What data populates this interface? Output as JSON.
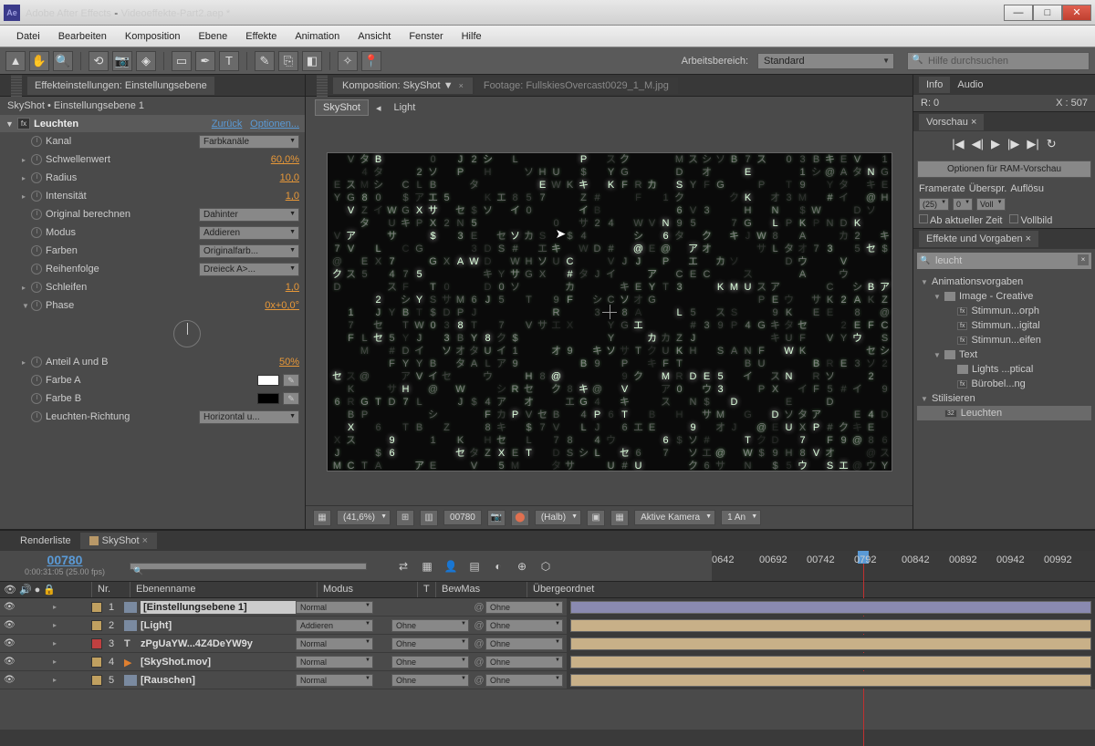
{
  "titlebar": {
    "app": "Adobe After Effects",
    "file": "Videoeffekte-Part2.aep *"
  },
  "menu": [
    "Datei",
    "Bearbeiten",
    "Komposition",
    "Ebene",
    "Effekte",
    "Animation",
    "Ansicht",
    "Fenster",
    "Hilfe"
  ],
  "toolbar": {
    "workspace_label": "Arbeitsbereich:",
    "workspace": "Standard",
    "search_placeholder": "Hilfe durchsuchen"
  },
  "effects_panel": {
    "tab": "Effekteinstellungen: Einstellungsebene",
    "path": "SkyShot • Einstellungsebene 1",
    "effect_name": "Leuchten",
    "links": {
      "reset": "Zurück",
      "options": "Optionen..."
    },
    "props": {
      "kanal": {
        "label": "Kanal",
        "value": "Farbkanäle"
      },
      "schwellenwert": {
        "label": "Schwellenwert",
        "value": "60,0%"
      },
      "radius": {
        "label": "Radius",
        "value": "10,0"
      },
      "intensitaet": {
        "label": "Intensität",
        "value": "1,0"
      },
      "original": {
        "label": "Original berechnen",
        "value": "Dahinter"
      },
      "modus": {
        "label": "Modus",
        "value": "Addieren"
      },
      "farben": {
        "label": "Farben",
        "value": "Originalfarb..."
      },
      "reihenfolge": {
        "label": "Reihenfolge",
        "value": "Dreieck A>..."
      },
      "schleifen": {
        "label": "Schleifen",
        "value": "1,0"
      },
      "phase": {
        "label": "Phase",
        "value": "0x+0,0°"
      },
      "anteil": {
        "label": "Anteil A und B",
        "value": "50%"
      },
      "farbeA": {
        "label": "Farbe A",
        "swatch": "#ffffff"
      },
      "farbeB": {
        "label": "Farbe B",
        "swatch": "#000000"
      },
      "richtung": {
        "label": "Leuchten-Richtung",
        "value": "Horizontal u..."
      }
    }
  },
  "comp_panel": {
    "tab_active": "Komposition: SkyShot",
    "tab_inactive": "Footage: FullskiesOvercast0029_1_M.jpg",
    "breadcrumb": [
      "SkyShot",
      "Light"
    ],
    "viewer_bar": {
      "zoom": "(41,6%)",
      "frame": "00780",
      "res": "(Halb)",
      "camera": "Aktive Kamera",
      "views": "1 An"
    }
  },
  "info_panel": {
    "tab1": "Info",
    "tab2": "Audio",
    "r": "R:  0",
    "x": "X : 507"
  },
  "preview_panel": {
    "tab": "Vorschau",
    "ram_btn": "Optionen für RAM-Vorschau",
    "labels": {
      "framerate": "Framerate",
      "skip": "Überspr.",
      "res": "Auflösu"
    },
    "values": {
      "framerate": "(25)",
      "skip": "0",
      "res": "Voll"
    },
    "checks": {
      "ab": "Ab aktueller Zeit",
      "vollbild": "Vollbild"
    }
  },
  "ep_panel": {
    "tab": "Effekte und Vorgaben",
    "search": "leucht",
    "tree": [
      {
        "d": 0,
        "tw": "▼",
        "label": "Animationsvorgaben"
      },
      {
        "d": 1,
        "tw": "▼",
        "icon": "folder",
        "label": "Image - Creative"
      },
      {
        "d": 2,
        "icon": "fx",
        "label": "Stimmun...orph"
      },
      {
        "d": 2,
        "icon": "fx",
        "label": "Stimmun...igital"
      },
      {
        "d": 2,
        "icon": "fx",
        "label": "Stimmun...eifen"
      },
      {
        "d": 1,
        "tw": "▼",
        "icon": "folder",
        "label": "Text"
      },
      {
        "d": 2,
        "tw": "",
        "icon": "folder",
        "label": "Lights ...ptical"
      },
      {
        "d": 2,
        "icon": "fx",
        "label": "Bürobel...ng"
      },
      {
        "d": 0,
        "tw": "▼",
        "label": "Stilisieren"
      },
      {
        "d": 1,
        "icon": "fx32",
        "label": "Leuchten",
        "sel": true
      }
    ]
  },
  "timeline": {
    "tab1": "Renderliste",
    "tab2": "SkyShot",
    "timecode": "00780",
    "fps": "0:00:31:05 (25.00 fps)",
    "ruler": [
      "0642",
      "00692",
      "00742",
      "0792",
      "00842",
      "00892",
      "00942",
      "00992"
    ],
    "cols": {
      "nr": "Nr.",
      "name": "Ebenenname",
      "modus": "Modus",
      "t": "T",
      "bewmas": "BewMas",
      "parent": "Übergeordnet"
    },
    "layers": [
      {
        "num": "1",
        "color": "#c0a060",
        "icon": "adj",
        "name": "[Einstellungsebene 1]",
        "sel": true,
        "modus": "Normal",
        "bewmas": "",
        "parent": "Ohne",
        "bar": "#8a8ab0"
      },
      {
        "num": "2",
        "color": "#c0a060",
        "icon": "light",
        "name": "[Light]",
        "modus": "Addieren",
        "bewmas": "Ohne",
        "parent": "Ohne",
        "bar": "#c8b088"
      },
      {
        "num": "3",
        "color": "#c04040",
        "icon": "T",
        "name": "zPgUaYW...4Z4DeYW9y",
        "modus": "Normal",
        "bewmas": "Ohne",
        "parent": "Ohne",
        "bar": "#c8b088"
      },
      {
        "num": "4",
        "color": "#c0a060",
        "icon": "mov",
        "name": "[SkyShot.mov]",
        "modus": "Normal",
        "bewmas": "Ohne",
        "parent": "Ohne",
        "bar": "#c8b088"
      },
      {
        "num": "5",
        "color": "#c0a060",
        "icon": "comp",
        "name": "[Rauschen]",
        "modus": "Normal",
        "bewmas": "Ohne",
        "parent": "Ohne",
        "bar": "#c8b088"
      }
    ]
  }
}
